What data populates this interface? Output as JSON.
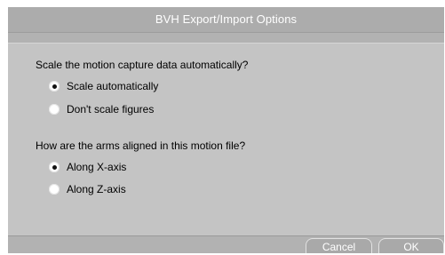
{
  "dialog": {
    "title": "BVH Export/Import Options"
  },
  "scale_group": {
    "question": "Scale the motion capture data automatically?",
    "options": [
      {
        "label": "Scale automatically",
        "selected": true
      },
      {
        "label": "Don't scale figures",
        "selected": false
      }
    ]
  },
  "arms_group": {
    "question": "How are the arms aligned in this motion file?",
    "options": [
      {
        "label": "Along X-axis",
        "selected": true
      },
      {
        "label": "Along Z-axis",
        "selected": false
      }
    ]
  },
  "buttons": {
    "cancel_label": "Cancel",
    "ok_label": "OK"
  },
  "colors": {
    "dialog_bg": "#b2b2b2",
    "panel_bg": "#c4c4c4",
    "title_text": "#ffffff",
    "button_text": "#ffffff"
  },
  "icons": {
    "radio_selected": "radio-selected-icon",
    "radio_unselected": "radio-unselected-icon"
  }
}
